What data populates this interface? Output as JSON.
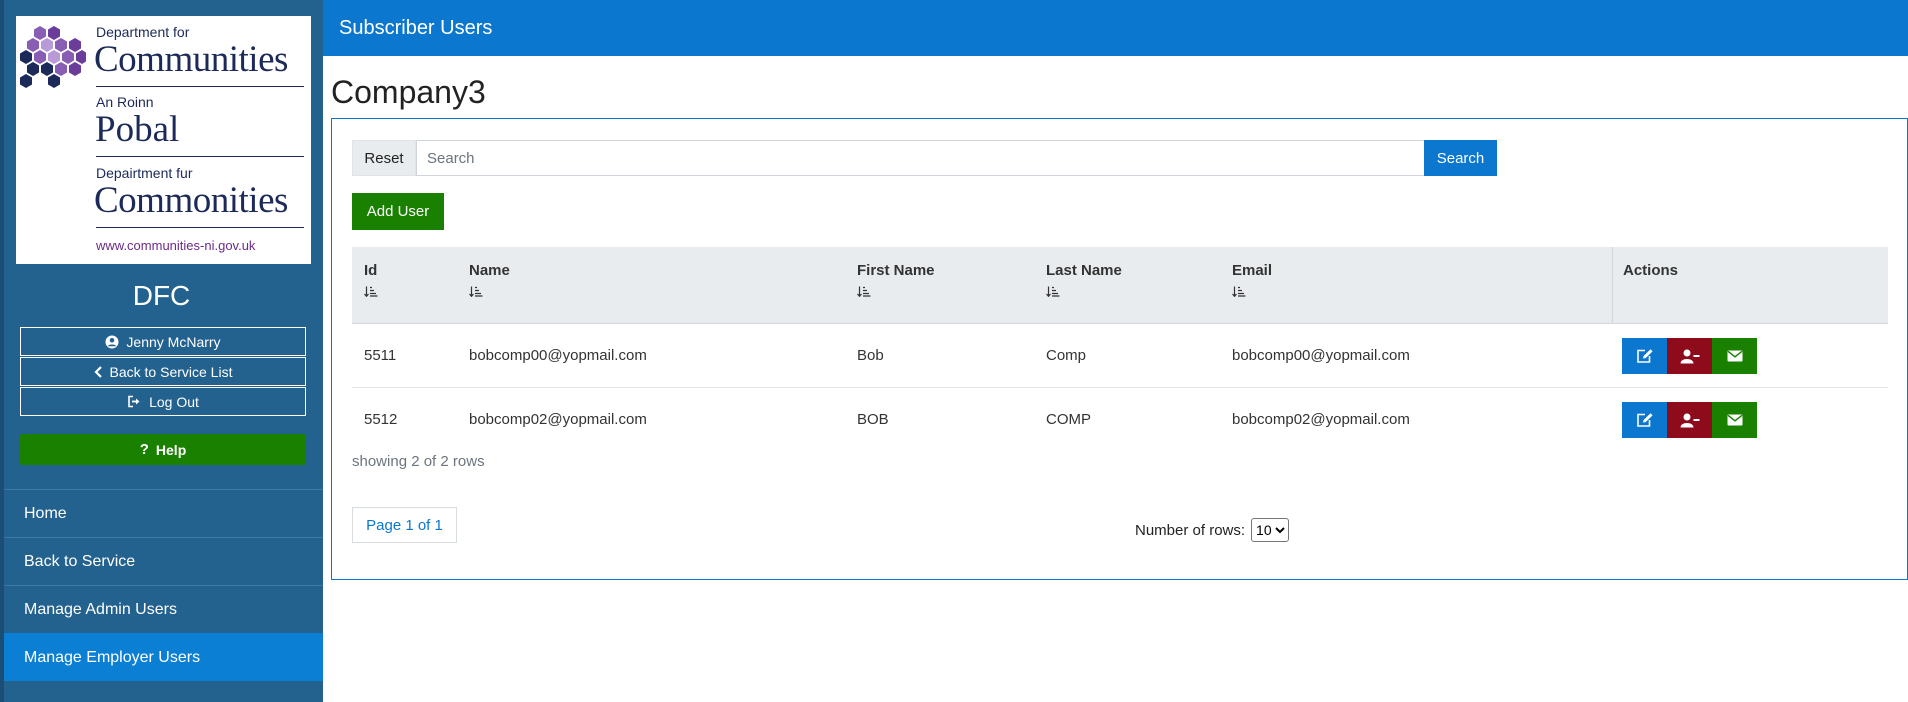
{
  "sidebar": {
    "logo": {
      "line1": "Department for",
      "line2": "Communities",
      "line3": "An Roinn",
      "line4": "Pobal",
      "line5": "Depairtment fur",
      "line6": "Commonities",
      "url": "www.communities-ni.gov.uk"
    },
    "org": "DFC",
    "user_label": "Jenny McNarry",
    "back_service_list_label": "Back to Service List",
    "logout_label": "Log Out",
    "help_label": "Help",
    "nav": [
      {
        "label": "Home"
      },
      {
        "label": "Back to Service"
      },
      {
        "label": "Manage Admin Users"
      },
      {
        "label": "Manage Employer Users"
      }
    ]
  },
  "header": {
    "title": "Subscriber Users"
  },
  "page": {
    "title": "Company3"
  },
  "search": {
    "reset_label": "Reset",
    "placeholder": "Search",
    "button_label": "Search"
  },
  "add_user_label": "Add User",
  "table": {
    "columns": [
      "Id",
      "Name",
      "First Name",
      "Last Name",
      "Email",
      "Actions"
    ],
    "rows": [
      {
        "id": "5511",
        "name": "bobcomp00@yopmail.com",
        "first": "Bob",
        "last": "Comp",
        "email": "bobcomp00@yopmail.com"
      },
      {
        "id": "5512",
        "name": "bobcomp02@yopmail.com",
        "first": "BOB",
        "last": "COMP",
        "email": "bobcomp02@yopmail.com"
      }
    ]
  },
  "footer": {
    "showing": "showing 2 of 2 rows",
    "page_label": "Page 1 of 1",
    "rows_label": "Number of rows:",
    "rows_value": "10"
  },
  "colors": {
    "primary": "#0b77cf",
    "sidebar": "#23618e",
    "success": "#198000",
    "danger": "#8e0b1c"
  }
}
